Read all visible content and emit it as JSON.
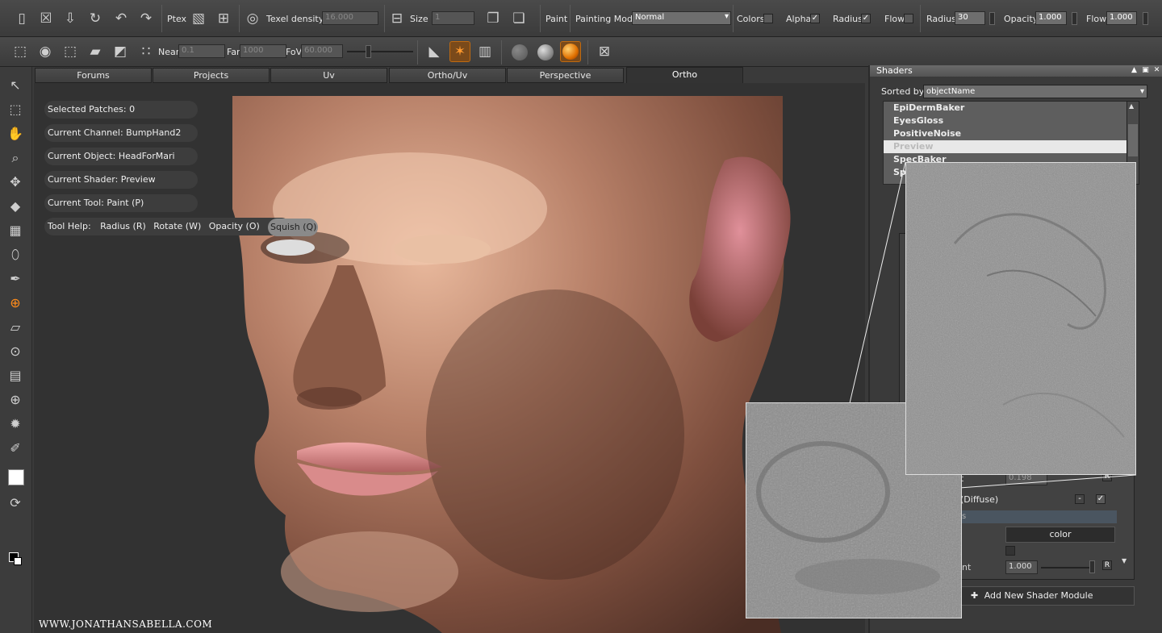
{
  "toolbar_top": {
    "icons": [
      "new-icon",
      "close-icon",
      "import-icon",
      "export-icon",
      "undo-icon",
      "redo-icon"
    ],
    "ptex_label": "Ptex",
    "texel_density_label": "Texel density :",
    "texel_density_value": "16.000",
    "size_label": "Size :",
    "size_value": "1",
    "paint_label": "Paint",
    "painting_mode_label": "Painting Mode",
    "painting_mode_value": "Normal",
    "colors_label": "Colors",
    "colors_checked": false,
    "alpha_label": "Alpha",
    "alpha_checked": true,
    "radius_check_label": "Radius",
    "radius_checked": true,
    "flow_check_label": "Flow",
    "flow_checked": false,
    "radius_label": "Radius",
    "radius_value": "30",
    "opacity_label": "Opacity",
    "opacity_value": "1.000",
    "flow_label": "Flow",
    "flow_value": "1.000",
    "check_mark": "✓"
  },
  "toolbar_second": {
    "near_label": "Near",
    "near_value": "0.1",
    "far_label": "Far",
    "far_value": "1000",
    "fov_label": "FoV",
    "fov_value": "60.000"
  },
  "tabs": [
    "Forums",
    "Projects",
    "Uv",
    "Ortho/Uv",
    "Perspective",
    "Ortho"
  ],
  "active_tab": "Ortho",
  "hud": {
    "selected_patches": "Selected Patches: 0",
    "current_channel": "Current Channel: BumpHand2",
    "current_object": "Current Object: HeadForMari",
    "current_shader": "Current Shader: Preview",
    "current_tool": "Current Tool: Paint (P)",
    "tool_help": "Tool Help:",
    "help_items": [
      "Radius (R)",
      "Rotate (W)",
      "Opacity (O)"
    ],
    "squish": "Squish (Q)"
  },
  "watermark": "WWW.JONATHANSABELLA.COM",
  "shaders_panel": {
    "title": "Shaders",
    "sorted_by_label": "Sorted by",
    "sorted_by_value": "objectName",
    "items": [
      "EpiDermBaker",
      "EyesGloss",
      "PositiveNoise",
      "Preview",
      "SpecBaker",
      "Sp"
    ],
    "selected_item": "Preview",
    "partial_value": "0.198",
    "partial_t": "t",
    "partial_diffuse": "(Diffuse)",
    "partial_s": "s",
    "color_button": "color",
    "partial_nt": "nt",
    "amount_value": "1.000",
    "r_label": "R",
    "minus_label": "-",
    "add_module": "Add New Shader Module"
  }
}
